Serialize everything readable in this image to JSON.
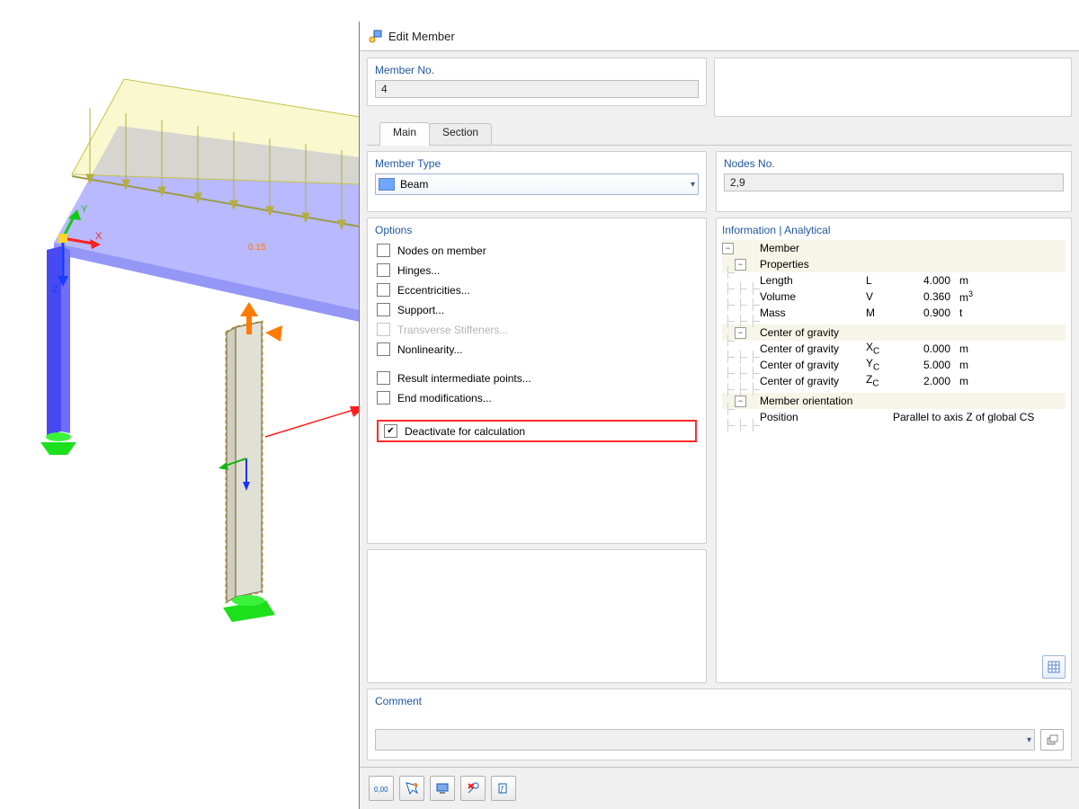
{
  "title": "Edit Member",
  "memberNo": {
    "label": "Member No.",
    "value": "4"
  },
  "nodesNo": {
    "label": "Nodes No.",
    "value": "2,9"
  },
  "tabs": {
    "main": "Main",
    "section": "Section"
  },
  "memberType": {
    "label": "Member Type",
    "value": "Beam"
  },
  "options": {
    "label": "Options",
    "nodes_on_member": "Nodes on member",
    "hinges": "Hinges...",
    "eccentricities": "Eccentricities...",
    "support": "Support...",
    "transverse": "Transverse Stiffeners...",
    "nonlinearity": "Nonlinearity...",
    "result_pts": "Result intermediate points...",
    "end_mod": "End modifications...",
    "deactivate": "Deactivate for calculation"
  },
  "info": {
    "label": "Information | Analytical",
    "member": "Member",
    "properties": "Properties",
    "length": {
      "name": "Length",
      "sym": "L",
      "val": "4.000",
      "unit": "m"
    },
    "volume": {
      "name": "Volume",
      "sym": "V",
      "val": "0.360",
      "unit": "m",
      "sup": "3"
    },
    "mass": {
      "name": "Mass",
      "sym": "M",
      "val": "0.900",
      "unit": "t"
    },
    "cog": "Center of gravity",
    "cog_x": {
      "name": "Center of gravity",
      "sym": "X",
      "sub": "C",
      "val": "0.000",
      "unit": "m"
    },
    "cog_y": {
      "name": "Center of gravity",
      "sym": "Y",
      "sub": "C",
      "val": "5.000",
      "unit": "m"
    },
    "cog_z": {
      "name": "Center of gravity",
      "sym": "Z",
      "sub": "C",
      "val": "2.000",
      "unit": "m"
    },
    "orient": "Member orientation",
    "position": {
      "name": "Position",
      "val": "Parallel to axis Z of global CS"
    }
  },
  "comment": {
    "label": "Comment"
  },
  "axes": {
    "x": "X",
    "y": "Y",
    "z": "Z"
  },
  "load_label": "0.15"
}
